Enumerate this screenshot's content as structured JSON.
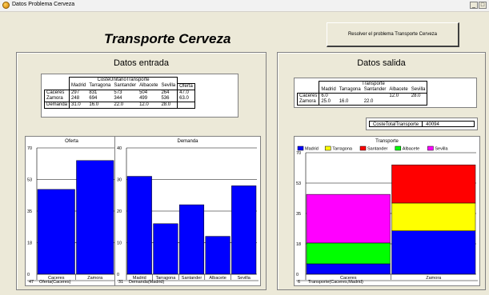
{
  "window": {
    "title": "Datos Problema Cerveza",
    "minimize_label": "_",
    "maximize_label": "□"
  },
  "main_title": "Transporte Cerveza",
  "solve_button_label": "Resolver el problema Transporte Cerveza",
  "entrada": {
    "title": "Datos entrada",
    "table": {
      "caption": "CosteUnitarioTransporte",
      "columns": [
        "Madrid",
        "Tarragona",
        "Santander",
        "Albacete",
        "Sevilla"
      ],
      "extra_column": "Oferta",
      "rows": [
        {
          "label": "Caceres",
          "values": [
            "297",
            "831",
            "573",
            "504",
            "264"
          ],
          "extra": "47.0"
        },
        {
          "label": "Zamora",
          "values": [
            "248",
            "694",
            "344",
            "499",
            "536"
          ],
          "extra": "63.0"
        },
        {
          "label": "Demanda",
          "values": [
            "31.0",
            "16.0",
            "22.0",
            "12.0",
            "28.0"
          ],
          "extra": ""
        }
      ]
    }
  },
  "salida": {
    "title": "Datos salida",
    "table": {
      "caption": "Transporte",
      "columns": [
        "Madrid",
        "Tarragona",
        "Santander",
        "Albacete",
        "Sevilla"
      ],
      "rows": [
        {
          "label": "Caceres",
          "values": [
            "6.0",
            "",
            "",
            "12.0",
            "28.0"
          ]
        },
        {
          "label": "Zamora",
          "values": [
            "25.0",
            "16.0",
            "22.0",
            "",
            ""
          ]
        }
      ]
    },
    "coste_label": "CosteTotalTransporte",
    "coste_value": "40094"
  },
  "colors": {
    "blue": "#0000ff",
    "yellow": "#ffff00",
    "red": "#ff0000",
    "green": "#00ff00",
    "magenta": "#ff00ff"
  },
  "chart_data": [
    {
      "id": "oferta",
      "type": "bar",
      "title": "Oferta",
      "categories": [
        "Caceres",
        "Zamora"
      ],
      "values": [
        47,
        63
      ],
      "yticks": [
        "0",
        "18",
        "35",
        "53",
        "70"
      ],
      "ylim": [
        0,
        70
      ],
      "footer_value": "47",
      "footer_label": "Oferta(Caceres)",
      "color": "#0000ff",
      "grid": true
    },
    {
      "id": "demanda",
      "type": "bar",
      "title": "Demanda",
      "categories": [
        "Madrid",
        "Tarragona",
        "Santander",
        "Albacete",
        "Sevilla"
      ],
      "values": [
        31,
        16,
        22,
        12,
        28
      ],
      "yticks": [
        "0",
        "10",
        "20",
        "30",
        "40"
      ],
      "ylim": [
        0,
        40
      ],
      "footer_value": "31",
      "footer_label": "Demanda(Madrid)",
      "color": "#0000ff",
      "grid": true
    },
    {
      "id": "transporte",
      "type": "stacked-bar",
      "title": "Transporte",
      "categories": [
        "Caceres",
        "Zamora"
      ],
      "series": [
        {
          "name": "Madrid",
          "values": [
            6,
            25
          ],
          "color": "#0000ff"
        },
        {
          "name": "Tarragona",
          "values": [
            0,
            16
          ],
          "color": "#ffff00"
        },
        {
          "name": "Santander",
          "values": [
            0,
            22
          ],
          "color": "#ff0000"
        },
        {
          "name": "Albacete",
          "values": [
            12,
            0
          ],
          "color": "#00ff00"
        },
        {
          "name": "Sevilla",
          "values": [
            28,
            0
          ],
          "color": "#ff00ff"
        }
      ],
      "yticks": [
        "0",
        "18",
        "35",
        "53",
        "70"
      ],
      "ylim": [
        0,
        70
      ],
      "legend": "top",
      "footer_value": "6",
      "footer_label": "Transporte(Caceres,Madrid)",
      "grid": true
    }
  ]
}
